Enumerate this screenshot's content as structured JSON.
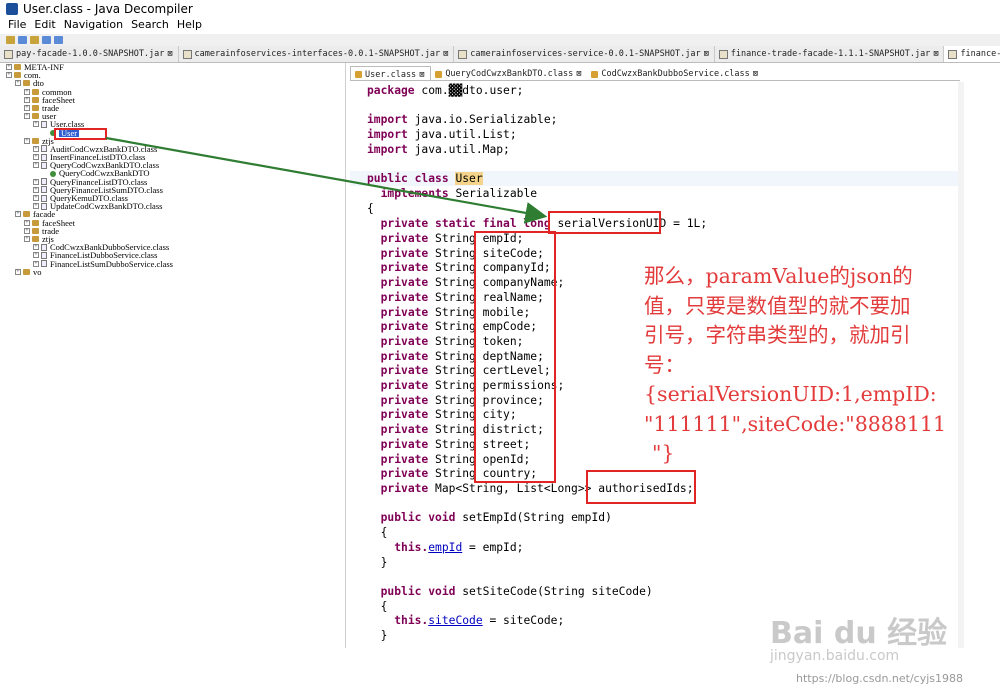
{
  "window": {
    "title": "User.class - Java Decompiler"
  },
  "menu": [
    "File",
    "Edit",
    "Navigation",
    "Search",
    "Help"
  ],
  "file_tabs": [
    "pay-facade-1.0.0-SNAPSHOT.jar",
    "camerainfoservices-interfaces-0.0.1-SNAPSHOT.jar",
    "camerainfoservices-service-0.0.1-SNAPSHOT.jar",
    "finance-trade-facade-1.1.1-SNAPSHOT.jar",
    "finance-trade-facade-1.1"
  ],
  "tree": [
    {
      "label": "META-INF",
      "indent": 0,
      "icon": "pkg"
    },
    {
      "label": "com.",
      "indent": 0,
      "icon": "pkg"
    },
    {
      "label": "dto",
      "indent": 1,
      "icon": "pkg"
    },
    {
      "label": "common",
      "indent": 2,
      "icon": "pkg"
    },
    {
      "label": "faceSheet",
      "indent": 2,
      "icon": "pkg"
    },
    {
      "label": "trade",
      "indent": 2,
      "icon": "pkg"
    },
    {
      "label": "user",
      "indent": 2,
      "icon": "pkg"
    },
    {
      "label": "User.class",
      "indent": 3,
      "icon": "file"
    },
    {
      "label": "User",
      "indent": 4,
      "icon": "cls",
      "selected": true
    },
    {
      "label": "ztjs",
      "indent": 2,
      "icon": "pkg"
    },
    {
      "label": "AuditCodCwzxBankDTO.class",
      "indent": 3,
      "icon": "file"
    },
    {
      "label": "InsertFinanceListDTO.class",
      "indent": 3,
      "icon": "file"
    },
    {
      "label": "QueryCodCwzxBankDTO.class",
      "indent": 3,
      "icon": "file"
    },
    {
      "label": "QueryCodCwzxBankDTO",
      "indent": 4,
      "icon": "cls"
    },
    {
      "label": "QueryFinanceListDTO.class",
      "indent": 3,
      "icon": "file"
    },
    {
      "label": "QueryFinanceListSumDTO.class",
      "indent": 3,
      "icon": "file"
    },
    {
      "label": "QueryKemuDTO.class",
      "indent": 3,
      "icon": "file"
    },
    {
      "label": "UpdateCodCwzxBankDTO.class",
      "indent": 3,
      "icon": "file"
    },
    {
      "label": "facade",
      "indent": 1,
      "icon": "pkg"
    },
    {
      "label": "faceSheet",
      "indent": 2,
      "icon": "pkg"
    },
    {
      "label": "trade",
      "indent": 2,
      "icon": "pkg"
    },
    {
      "label": "ztjs",
      "indent": 2,
      "icon": "pkg"
    },
    {
      "label": "CodCwzxBankDubboService.class",
      "indent": 3,
      "icon": "file"
    },
    {
      "label": "FinanceListDubboService.class",
      "indent": 3,
      "icon": "file"
    },
    {
      "label": "FinanceListSumDubboService.class",
      "indent": 3,
      "icon": "file"
    },
    {
      "label": "vo",
      "indent": 1,
      "icon": "pkg"
    }
  ],
  "editor_tabs": [
    "User.class",
    "QueryCodCwzxBankDTO.class",
    "CodCwzxBankDubboService.class"
  ],
  "code": {
    "package_kw": "package",
    "package_name": "com.",
    "package_rest": "dto.user;",
    "imports": [
      "java.io.Serializable;",
      "java.util.List;",
      "java.util.Map;"
    ],
    "import_kw": "import",
    "class_decl_kw": "public class",
    "class_name": "User",
    "implements_kw": "implements",
    "implements_name": "Serializable",
    "open_brace": "{",
    "svuid_mods": "private static final long",
    "svuid_name": "serialVersionUID",
    "svuid_value": "= 1L;",
    "field_mod": "private",
    "field_type": "String",
    "fields": [
      "empId;",
      "siteCode;",
      "companyId;",
      "companyName;",
      "realName;",
      "mobile;",
      "empCode;",
      "token;",
      "deptName;",
      "certLevel;",
      "permissions;",
      "province;",
      "city;",
      "district;",
      "street;",
      "openId;",
      "country;"
    ],
    "map_type": "Map<String, List<Long>>",
    "map_name": "authorisedIds;",
    "method1_sig": "setEmpId(String empId)",
    "method1_field": "empId",
    "method1_assign": " = empId;",
    "method2_sig": "setSiteCode(String siteCode)",
    "method2_field": "siteCode",
    "method2_assign": " = siteCode;",
    "public_void": "public void",
    "this_kw": "this.",
    "brace_open": "{",
    "brace_close": "}"
  },
  "annotation": [
    "那么，paramValue的json的",
    "值，只要是数值型的就不要加",
    "引号，字符串类型的，就加引",
    "号：",
    "{serialVersionUID:1,empID:",
    "\"111111\",siteCode:\"8888111",
    "\"}"
  ],
  "watermark": {
    "brand": "Bai du 经验",
    "site": "jingyan.baidu.com",
    "blog": "https://blog.csdn.net/cyjs1988"
  },
  "colors": {
    "annotation": "#e33b3b",
    "box": "#e12424",
    "arrow": "#2e7d32",
    "keyword": "#7f0055"
  }
}
